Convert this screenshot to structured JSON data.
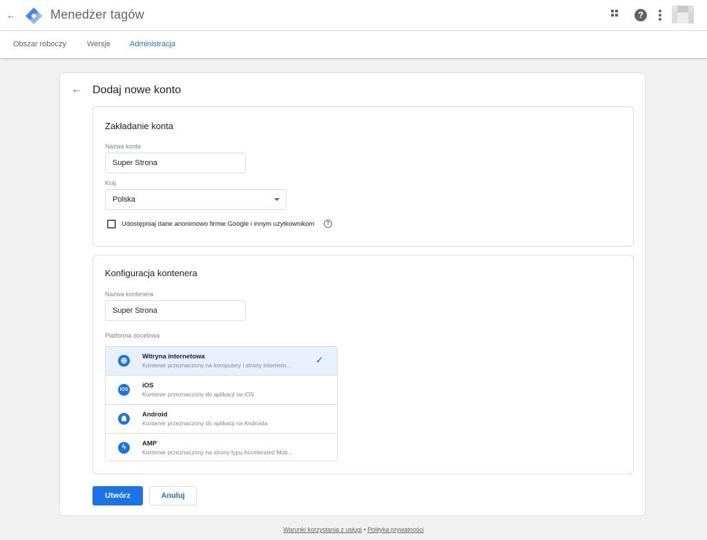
{
  "header": {
    "title": "Menedżer tagów",
    "back_icon": "arrow-back-icon",
    "logo_icon": "tag-manager-logo",
    "apps_icon": "apps-grid-icon",
    "help_icon": "help-icon",
    "help_glyph": "?",
    "more_icon": "more-vert-icon",
    "avatar": "account-avatar"
  },
  "tabs": [
    {
      "label": "Obszar roboczy",
      "active": false
    },
    {
      "label": "Wersje",
      "active": false
    },
    {
      "label": "Administracja",
      "active": true
    }
  ],
  "page": {
    "back_icon": "arrow-back-icon",
    "title": "Dodaj nowe konto"
  },
  "account_section": {
    "title": "Zakładanie konta",
    "name_label": "Nazwa konta",
    "name_value": "Super Strona",
    "country_label": "Kraj",
    "country_value": "Polska",
    "share_label": "Udostępniaj dane anonimowo firmie Google i innym użytkownikom",
    "share_checked": false,
    "help_glyph": "?"
  },
  "container_section": {
    "title": "Konfiguracja kontenera",
    "name_label": "Nazwa kontenera",
    "name_value": "Super Strona",
    "platform_label": "Platforma docelowa",
    "platforms": [
      {
        "name": "Witryna internetowa",
        "desc": "Kontener przeznaczony na komputery i strony interneto...",
        "icon": "globe-icon",
        "glyph": "⊕",
        "selected": true
      },
      {
        "name": "iOS",
        "desc": "Kontener przeznaczony do aplikacji na iOS",
        "icon": "ios-icon",
        "glyph": "iOS",
        "selected": false
      },
      {
        "name": "Android",
        "desc": "Kontener przeznaczony do aplikacji na Androida",
        "icon": "android-icon",
        "glyph": "",
        "selected": false
      },
      {
        "name": "AMP",
        "desc": "Kontener przeznaczony na strony typu Accelerated Mob...",
        "icon": "amp-icon",
        "glyph": "ϟ",
        "selected": false
      }
    ],
    "check_glyph": "✓"
  },
  "actions": {
    "create_label": "Utwórz",
    "cancel_label": "Anuluj"
  },
  "footer": {
    "terms_label": "Warunki korzystania z usługi",
    "separator": "•",
    "privacy_label": "Polityka prywatności"
  },
  "colors": {
    "accent": "#1a73e8",
    "selected_bg": "#e8f0fe",
    "page_bg": "#f1f1f1"
  }
}
